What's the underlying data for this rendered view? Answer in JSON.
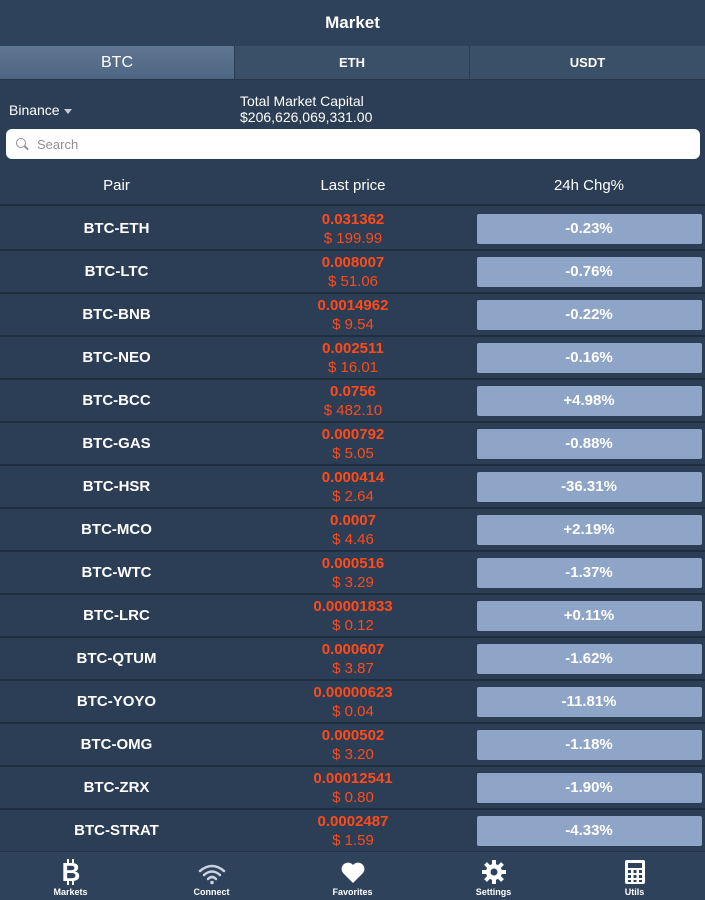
{
  "header": {
    "title": "Market"
  },
  "tabs": [
    {
      "label": "BTC",
      "active": true
    },
    {
      "label": "ETH",
      "active": false
    },
    {
      "label": "USDT",
      "active": false
    }
  ],
  "info": {
    "exchange": "Binance",
    "cap_label": "Total Market Capital",
    "cap_value": "$206,626,069,331.00"
  },
  "search": {
    "placeholder": "Search"
  },
  "columns": {
    "pair": "Pair",
    "price": "Last price",
    "change": "24h Chg%"
  },
  "rows": [
    {
      "pair": "BTC-ETH",
      "btc": "0.031362",
      "usd": "$ 199.99",
      "chg": "-0.23%"
    },
    {
      "pair": "BTC-LTC",
      "btc": "0.008007",
      "usd": "$ 51.06",
      "chg": "-0.76%"
    },
    {
      "pair": "BTC-BNB",
      "btc": "0.0014962",
      "usd": "$ 9.54",
      "chg": "-0.22%"
    },
    {
      "pair": "BTC-NEO",
      "btc": "0.002511",
      "usd": "$ 16.01",
      "chg": "-0.16%"
    },
    {
      "pair": "BTC-BCC",
      "btc": "0.0756",
      "usd": "$ 482.10",
      "chg": "+4.98%"
    },
    {
      "pair": "BTC-GAS",
      "btc": "0.000792",
      "usd": "$ 5.05",
      "chg": "-0.88%"
    },
    {
      "pair": "BTC-HSR",
      "btc": "0.000414",
      "usd": "$ 2.64",
      "chg": "-36.31%"
    },
    {
      "pair": "BTC-MCO",
      "btc": "0.0007",
      "usd": "$ 4.46",
      "chg": "+2.19%"
    },
    {
      "pair": "BTC-WTC",
      "btc": "0.000516",
      "usd": "$ 3.29",
      "chg": "-1.37%"
    },
    {
      "pair": "BTC-LRC",
      "btc": "0.00001833",
      "usd": "$ 0.12",
      "chg": "+0.11%"
    },
    {
      "pair": "BTC-QTUM",
      "btc": "0.000607",
      "usd": "$ 3.87",
      "chg": "-1.62%"
    },
    {
      "pair": "BTC-YOYO",
      "btc": "0.00000623",
      "usd": "$ 0.04",
      "chg": "-11.81%"
    },
    {
      "pair": "BTC-OMG",
      "btc": "0.000502",
      "usd": "$ 3.20",
      "chg": "-1.18%"
    },
    {
      "pair": "BTC-ZRX",
      "btc": "0.00012541",
      "usd": "$ 0.80",
      "chg": "-1.90%"
    },
    {
      "pair": "BTC-STRAT",
      "btc": "0.0002487",
      "usd": "$ 1.59",
      "chg": "-4.33%"
    }
  ],
  "tabbar": [
    {
      "label": "Markets",
      "icon": "bitcoin-icon"
    },
    {
      "label": "Connect",
      "icon": "wifi-icon"
    },
    {
      "label": "Favorites",
      "icon": "heart-icon"
    },
    {
      "label": "Settings",
      "icon": "gear-icon"
    },
    {
      "label": "Utils",
      "icon": "calculator-icon"
    }
  ],
  "colors": {
    "background": "#2c3e55",
    "price_text": "#ff4a1a",
    "change_box": "#8fa5c8",
    "active_tab": "#5f7691"
  }
}
